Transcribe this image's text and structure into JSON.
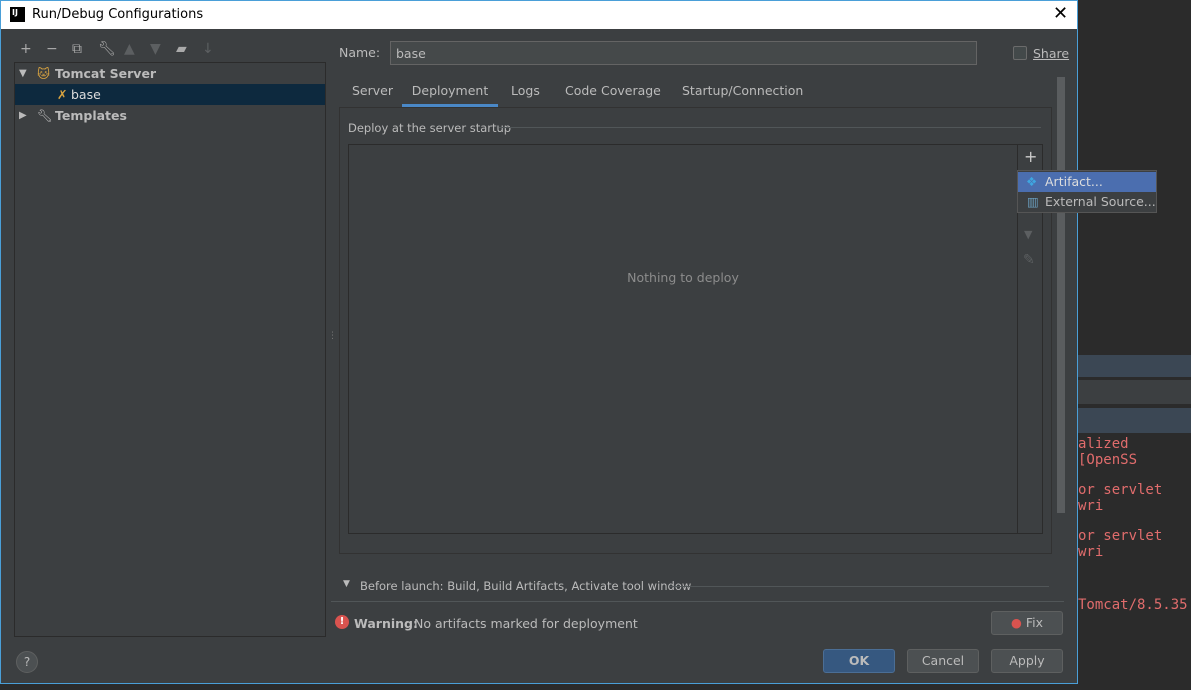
{
  "window": {
    "title": "Run/Debug Configurations",
    "logo": "IJ"
  },
  "toolbar": [
    "add-icon",
    "remove-icon",
    "copy-icon",
    "wrench-icon",
    "move-up-icon",
    "move-down-icon",
    "new-folder-icon",
    "sort-icon"
  ],
  "tree": {
    "items": [
      {
        "label": "Tomcat Server",
        "expanded": true
      },
      {
        "label": "base",
        "selected": true
      },
      {
        "label": "Templates",
        "expanded": false
      }
    ]
  },
  "name": {
    "label": "Name:",
    "value": "base"
  },
  "share": {
    "label": "Share",
    "checked": false
  },
  "tabs": [
    "Server",
    "Deployment",
    "Logs",
    "Code Coverage",
    "Startup/Connection"
  ],
  "active_tab": "Deployment",
  "deploy": {
    "heading": "Deploy at the server startup",
    "empty": "Nothing to deploy"
  },
  "popup": {
    "items": [
      "Artifact...",
      "External Source..."
    ]
  },
  "before_launch": "Before launch: Build, Build Artifacts, Activate tool window",
  "warning": {
    "bold": "Warning:",
    "text": "No artifacts marked for deployment"
  },
  "buttons": {
    "fix": "Fix",
    "ok": "OK",
    "cancel": "Cancel",
    "apply": "Apply",
    "help": "?"
  },
  "console": [
    "alized [OpenSS",
    "or servlet wri",
    "or servlet wri",
    "Tomcat/8.5.35"
  ],
  "colors": {
    "accent": "#4a88c7",
    "selection": "#0d293e",
    "popup_highlight": "#4b6eaf",
    "error": "#e06c6c",
    "ok_button": "#365880"
  }
}
